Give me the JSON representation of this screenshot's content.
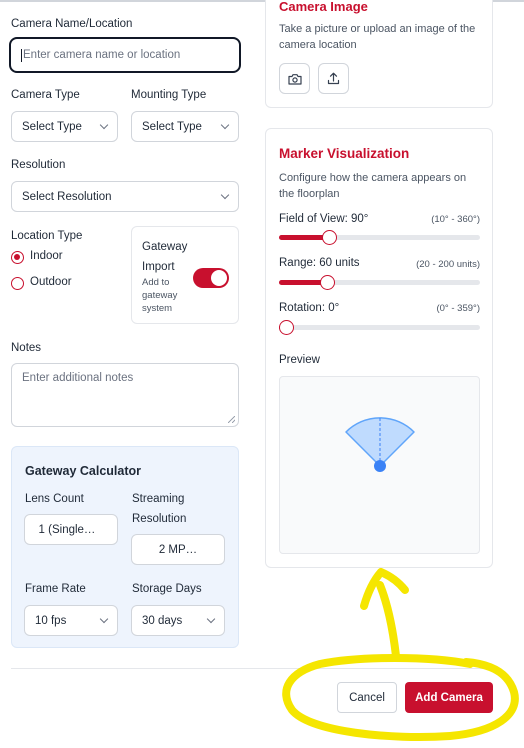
{
  "form": {
    "camera_name_label": "Camera Name/Location",
    "camera_name_placeholder": "Enter camera name or location",
    "camera_type_label": "Camera Type",
    "camera_type_value": "Select Type",
    "mounting_type_label": "Mounting Type",
    "mounting_type_value": "Select Type",
    "resolution_label": "Resolution",
    "resolution_value": "Select Resolution",
    "location_type_label": "Location Type",
    "location_options": [
      {
        "label": "Indoor",
        "selected": true
      },
      {
        "label": "Outdoor",
        "selected": false
      }
    ],
    "notes_label": "Notes",
    "notes_placeholder": "Enter additional notes"
  },
  "gateway": {
    "title": "Gateway",
    "import_label": "Import",
    "import_desc": [
      "Add to",
      "gateway",
      "system"
    ],
    "import_enabled": true
  },
  "calculator": {
    "title": "Gateway Calculator",
    "lens_count_label": "Lens Count",
    "lens_count_value": "1 (Single…",
    "streaming_label_1": "Streaming",
    "streaming_label_2": "Resolution",
    "streaming_value": "2 MP…",
    "frame_rate_label": "Frame Rate",
    "frame_rate_value": "10 fps",
    "storage_days_label": "Storage Days",
    "storage_days_value": "30 days"
  },
  "camera_image": {
    "title": "Camera Image",
    "desc_line1": "Take a picture or upload an image of the",
    "desc_line2": "camera location"
  },
  "marker": {
    "title": "Marker Visualization",
    "desc_line1": "Configure how the camera appears on",
    "desc_line2": "the floorplan",
    "fov_label": "Field of View: 90°",
    "fov_range": "(10° - 360°)",
    "fov_value": 90,
    "fov_min": 10,
    "fov_max": 360,
    "range_label": "Range: 60 units",
    "range_range": "(20 - 200 units)",
    "range_value": 60,
    "range_min": 20,
    "range_max": 200,
    "rotation_label": "Rotation: 0°",
    "rotation_range": "(0° - 359°)",
    "rotation_value": 0,
    "rotation_min": 0,
    "rotation_max": 359,
    "preview_label": "Preview"
  },
  "actions": {
    "cancel_label": "Cancel",
    "add_label": "Add Camera"
  },
  "colors": {
    "accent": "#c8102e",
    "preview_fill": "#bfdbfe",
    "preview_stroke": "#60a5fa",
    "camera_dot": "#3b82f6",
    "annotation": "#f5e600"
  },
  "icons": [
    "camera-icon",
    "upload-icon",
    "chevron-down-icon"
  ]
}
